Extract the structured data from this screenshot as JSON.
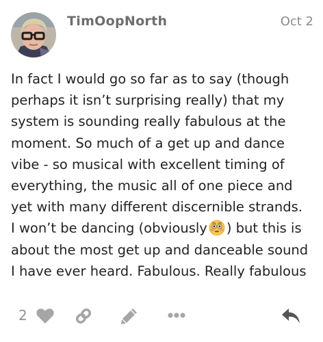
{
  "post": {
    "username": "TimOopNorth",
    "date": "Oct 2",
    "lines": [
      "In fact I would go so far as to say (though",
      "perhaps it isn’t surprising really) that my",
      "system is sounding really fabulous at the",
      "moment. So much of a get up and dance",
      "vibe - so musical with excellent timing of",
      "everything, the music all of one piece and",
      "yet with many different discernible strands."
    ],
    "line_emoji_before": "I won’t be dancing (obviously",
    "line_emoji_after": ") but this is",
    "lines_after": [
      "about the most get up and danceable sound",
      "I have ever heard. Fabulous. Really fabulous"
    ],
    "emoji": "flushed-face-emoji",
    "like_count": "2"
  },
  "actions": {
    "icons": [
      "heart-icon",
      "link-icon",
      "pencil-icon",
      "more-dots-icon",
      "reply-icon"
    ]
  },
  "colors": {
    "text": "#222222",
    "muted": "#8f8f8f",
    "icon": "#a6a6a6"
  }
}
